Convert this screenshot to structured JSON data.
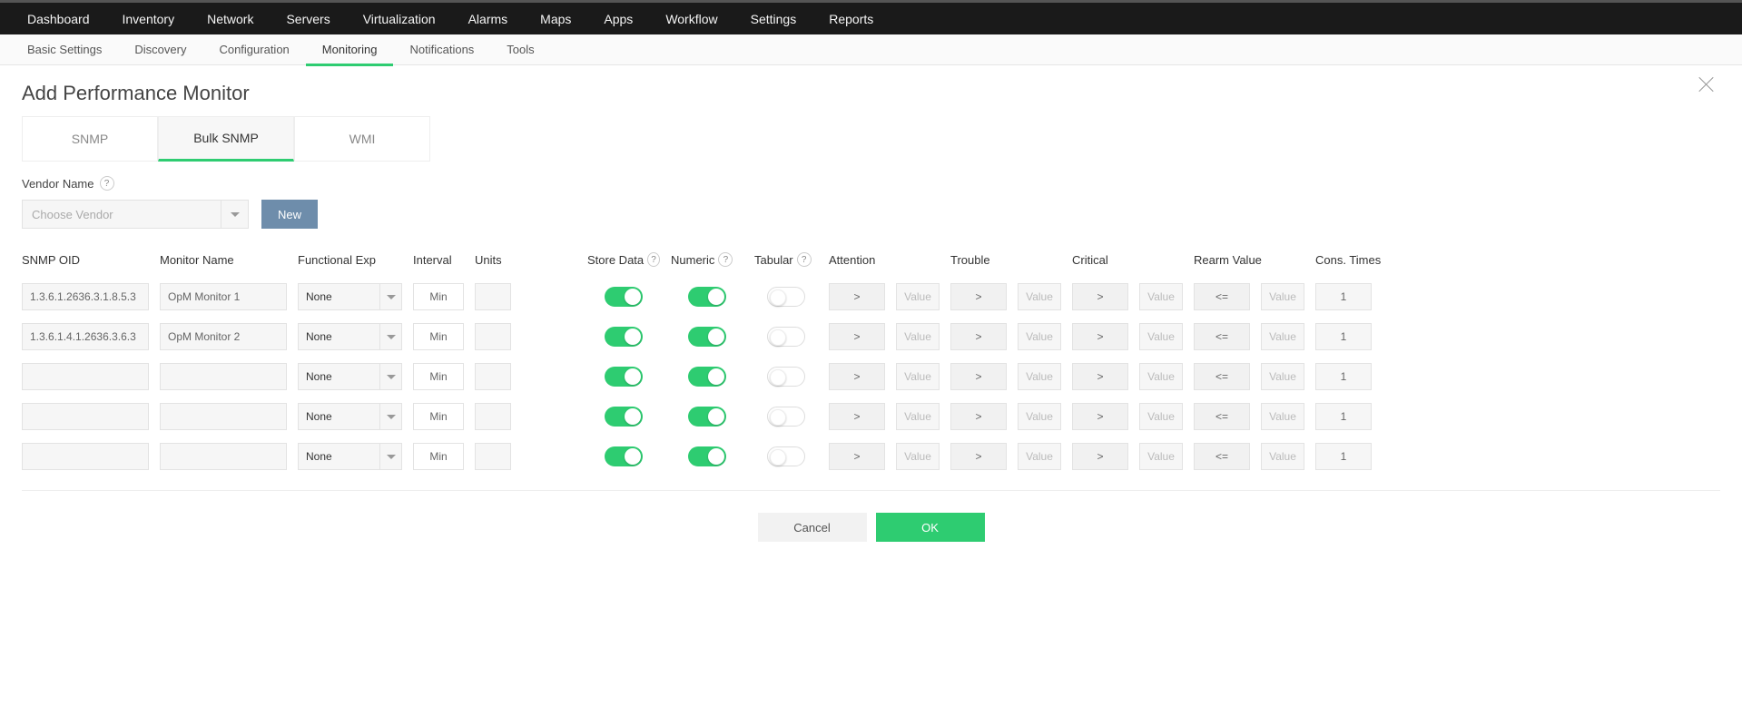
{
  "topnav": [
    "Dashboard",
    "Inventory",
    "Network",
    "Servers",
    "Virtualization",
    "Alarms",
    "Maps",
    "Apps",
    "Workflow",
    "Settings",
    "Reports"
  ],
  "subnav": {
    "items": [
      "Basic Settings",
      "Discovery",
      "Configuration",
      "Monitoring",
      "Notifications",
      "Tools"
    ],
    "active": "Monitoring"
  },
  "page": {
    "title": "Add Performance Monitor"
  },
  "tabs": {
    "items": [
      "SNMP",
      "Bulk SNMP",
      "WMI"
    ],
    "active": "Bulk SNMP"
  },
  "vendor": {
    "label": "Vendor Name",
    "placeholder": "Choose Vendor",
    "new_button": "New"
  },
  "columns": {
    "snmp_oid": "SNMP OID",
    "monitor_name": "Monitor Name",
    "functional_exp": "Functional Exp",
    "interval": "Interval",
    "units": "Units",
    "store_data": "Store Data",
    "numeric": "Numeric",
    "tabular": "Tabular",
    "attention": "Attention",
    "trouble": "Trouble",
    "critical": "Critical",
    "rearm_value": "Rearm Value",
    "cons_times": "Cons. Times"
  },
  "row_defaults": {
    "func_value": "None",
    "interval_label": "Min",
    "value_placeholder": "Value",
    "op_gt": ">",
    "op_lte": "<=",
    "cons_times_default": "1"
  },
  "rows": [
    {
      "oid": "1.3.6.1.2636.3.1.8.5.3",
      "name": "OpM Monitor 1",
      "store": true,
      "numeric": true,
      "tabular": false
    },
    {
      "oid": "1.3.6.1.4.1.2636.3.6.3",
      "name": "OpM Monitor 2",
      "store": true,
      "numeric": true,
      "tabular": false
    },
    {
      "oid": "",
      "name": "",
      "store": true,
      "numeric": true,
      "tabular": false
    },
    {
      "oid": "",
      "name": "",
      "store": true,
      "numeric": true,
      "tabular": false
    },
    {
      "oid": "",
      "name": "",
      "store": true,
      "numeric": true,
      "tabular": false
    }
  ],
  "buttons": {
    "cancel": "Cancel",
    "ok": "OK"
  }
}
